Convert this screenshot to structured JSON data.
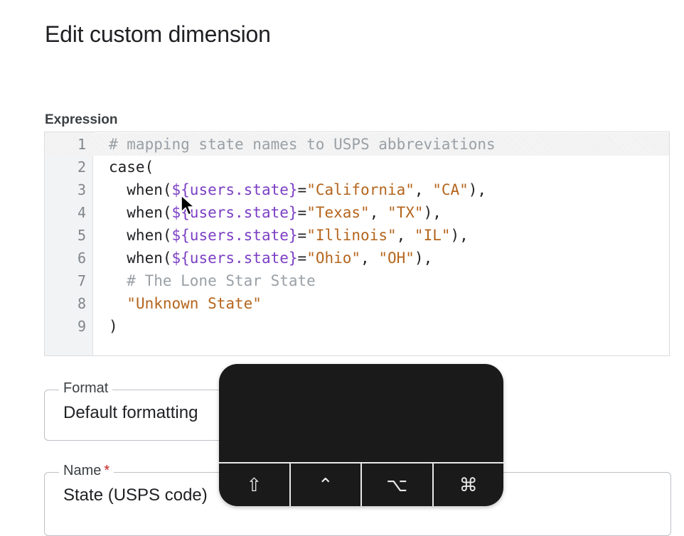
{
  "page": {
    "title": "Edit custom dimension"
  },
  "expression": {
    "label": "Expression",
    "lines": [
      {
        "number": "1",
        "active": true,
        "tokens": [
          {
            "t": "comment",
            "v": "# mapping state names to USPS abbreviations"
          }
        ]
      },
      {
        "number": "2",
        "tokens": [
          {
            "t": "plain",
            "v": "case("
          }
        ]
      },
      {
        "number": "3",
        "tokens": [
          {
            "t": "plain",
            "v": "  when("
          },
          {
            "t": "var",
            "v": "${users.state}"
          },
          {
            "t": "plain",
            "v": "="
          },
          {
            "t": "str",
            "v": "\"California\""
          },
          {
            "t": "plain",
            "v": ", "
          },
          {
            "t": "str",
            "v": "\"CA\""
          },
          {
            "t": "plain",
            "v": "),"
          }
        ]
      },
      {
        "number": "4",
        "tokens": [
          {
            "t": "plain",
            "v": "  when("
          },
          {
            "t": "var",
            "v": "${users.state}"
          },
          {
            "t": "plain",
            "v": "="
          },
          {
            "t": "str",
            "v": "\"Texas\""
          },
          {
            "t": "plain",
            "v": ", "
          },
          {
            "t": "str",
            "v": "\"TX\""
          },
          {
            "t": "plain",
            "v": "),"
          }
        ]
      },
      {
        "number": "5",
        "tokens": [
          {
            "t": "plain",
            "v": "  when("
          },
          {
            "t": "var",
            "v": "${users.state}"
          },
          {
            "t": "plain",
            "v": "="
          },
          {
            "t": "str",
            "v": "\"Illinois\""
          },
          {
            "t": "plain",
            "v": ", "
          },
          {
            "t": "str",
            "v": "\"IL\""
          },
          {
            "t": "plain",
            "v": "),"
          }
        ]
      },
      {
        "number": "6",
        "tokens": [
          {
            "t": "plain",
            "v": "  when("
          },
          {
            "t": "var",
            "v": "${users.state}"
          },
          {
            "t": "plain",
            "v": "="
          },
          {
            "t": "str",
            "v": "\"Ohio\""
          },
          {
            "t": "plain",
            "v": ", "
          },
          {
            "t": "str",
            "v": "\"OH\""
          },
          {
            "t": "plain",
            "v": "),"
          }
        ]
      },
      {
        "number": "7",
        "tokens": [
          {
            "t": "comment",
            "v": "  # The Lone Star State"
          }
        ]
      },
      {
        "number": "8",
        "tokens": [
          {
            "t": "plain",
            "v": "  "
          },
          {
            "t": "str",
            "v": "\"Unknown State\""
          }
        ]
      },
      {
        "number": "9",
        "tokens": [
          {
            "t": "plain",
            "v": ")"
          }
        ]
      }
    ]
  },
  "format": {
    "label": "Format",
    "value": "Default formatting"
  },
  "name": {
    "label": "Name",
    "required_mark": "*",
    "value": "State (USPS code)"
  },
  "key_overlay": {
    "modifiers": [
      {
        "name": "shift-key-icon",
        "glyph": "⇧"
      },
      {
        "name": "control-key-icon",
        "glyph": "⌃"
      },
      {
        "name": "option-key-icon",
        "glyph": "⌥"
      },
      {
        "name": "command-key-icon",
        "glyph": "⌘"
      }
    ]
  },
  "colors": {
    "comment": "#9aa0a6",
    "variable": "#7b3fc4",
    "string": "#b5651d",
    "overlay": "#1a1a1a"
  }
}
